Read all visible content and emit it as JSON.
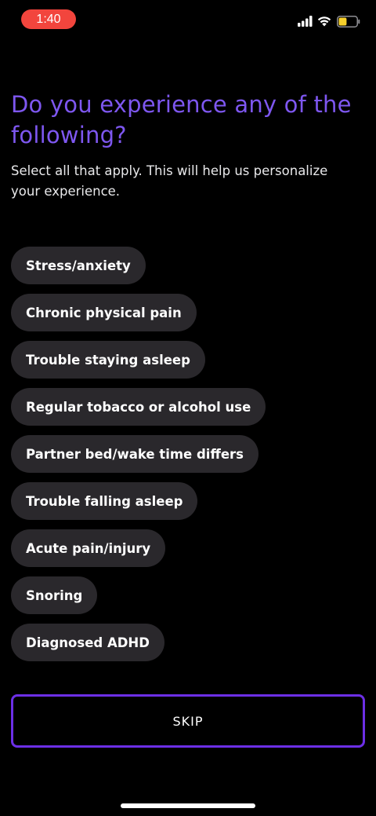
{
  "status_bar": {
    "time": "1:40",
    "time_pill_color": "#f2453d",
    "icons": [
      "signal-icon",
      "wifi-icon",
      "battery-icon"
    ],
    "battery_level_fraction": 0.45,
    "battery_color": "#f7d02c"
  },
  "header": {
    "title": "Do you experience any of the following?",
    "subtitle": "Select all that apply. This will help us personalize your experience.",
    "title_color": "#7e57f0"
  },
  "options": [
    {
      "label": "Stress/anxiety",
      "selected": false
    },
    {
      "label": "Chronic physical pain",
      "selected": false
    },
    {
      "label": "Trouble staying asleep",
      "selected": false
    },
    {
      "label": "Regular tobacco or alcohol use",
      "selected": false
    },
    {
      "label": "Partner bed/wake time differs",
      "selected": false
    },
    {
      "label": "Trouble falling asleep",
      "selected": false
    },
    {
      "label": "Acute pain/injury",
      "selected": false
    },
    {
      "label": "Snoring",
      "selected": false
    },
    {
      "label": "Diagnosed ADHD",
      "selected": false
    }
  ],
  "footer": {
    "skip_label": "SKIP",
    "skip_border_color": "#6c2fe6"
  }
}
